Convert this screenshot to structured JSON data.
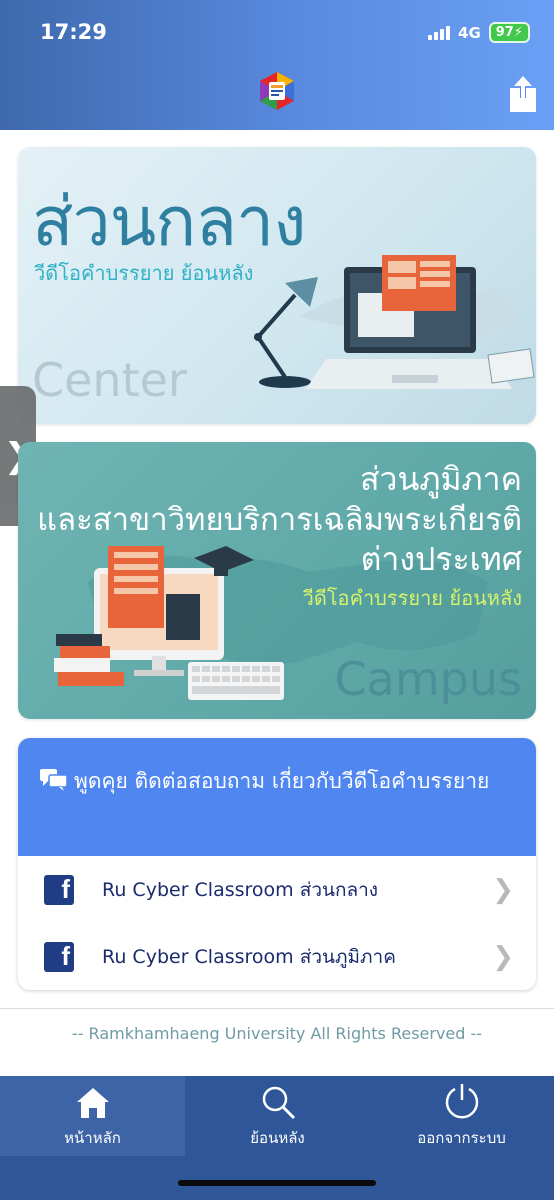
{
  "status_bar": {
    "time": "17:29",
    "network": "4G",
    "battery": "97"
  },
  "header": {
    "logo_icon": "ru-logo-icon",
    "share_icon": "share-icon"
  },
  "banners": {
    "center": {
      "title_th": "ส่วนกลาง",
      "subtitle_th": "วีดีโอคำบรรยาย ย้อนหลัง",
      "title_en": "Center"
    },
    "campus": {
      "line1": "ส่วนภูมิภาค",
      "line2": "และสาขาวิทยบริการเฉลิมพระเกียรติ",
      "line3": "ต่างประเทศ",
      "subtitle_th": "วีดีโอคำบรรยาย ย้อนหลัง",
      "title_en": "Campus"
    }
  },
  "side_toggle": {
    "glyph": "❯"
  },
  "chat": {
    "header": "พูดคุย ติดต่อสอบถาม เกี่ยวกับวีดีโอคำบรรยาย",
    "items": [
      {
        "label": "Ru Cyber Classroom ส่วนกลาง",
        "icon": "facebook-icon"
      },
      {
        "label": "Ru Cyber Classroom ส่วนภูมิภาค",
        "icon": "facebook-icon"
      }
    ]
  },
  "footer": {
    "copyright": "-- Ramkhamhaeng University All Rights Reserved --"
  },
  "tabs": [
    {
      "label": "หน้าหลัก",
      "icon": "home-icon",
      "active": true
    },
    {
      "label": "ย้อนหลัง",
      "icon": "search-icon",
      "active": false
    },
    {
      "label": "ออกจากระบบ",
      "icon": "power-icon",
      "active": false
    }
  ],
  "colors": {
    "header_start": "#3e69ad",
    "header_end": "#6aa0f5",
    "chat_header": "#4f86ef",
    "tabbar": "#2e5699",
    "facebook": "#1f3c84"
  }
}
